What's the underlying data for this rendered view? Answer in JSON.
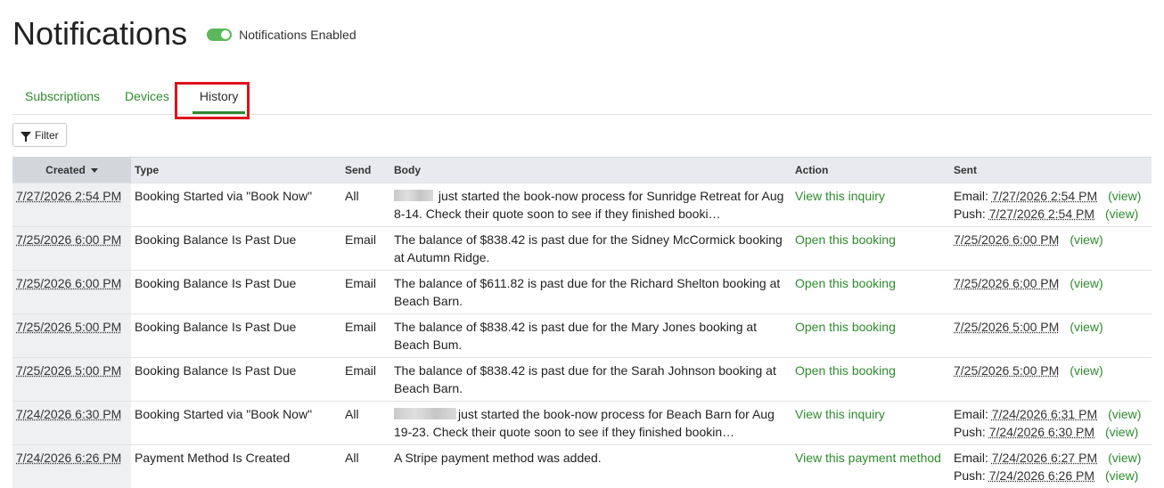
{
  "header": {
    "title": "Notifications",
    "toggle_label": "Notifications Enabled"
  },
  "tabs": [
    {
      "label": "Subscriptions"
    },
    {
      "label": "Devices"
    },
    {
      "label": "History"
    }
  ],
  "filter": {
    "label": "Filter"
  },
  "table": {
    "columns": [
      "Created",
      "Type",
      "Send",
      "Body",
      "Action",
      "Sent"
    ],
    "rows": [
      {
        "created": "7/27/2026 2:54 PM",
        "type": "Booking Started via \"Book Now\"",
        "send": "All",
        "body": " just started the book-now process for Sunridge Retreat for Aug 8-14. Check their quote soon to see if they finished booki…",
        "action": "View this inquiry",
        "sent": [
          {
            "label": "Email:",
            "time": "7/27/2026 2:54 PM",
            "view": "(view)"
          },
          {
            "label": "Push:",
            "time": "7/27/2026 2:54 PM",
            "view": "(view)"
          }
        ]
      },
      {
        "created": "7/25/2026 6:00 PM",
        "type": "Booking Balance Is Past Due",
        "send": "Email",
        "body": "The balance of $838.42 is past due for the Sidney McCormick booking at Autumn Ridge.",
        "action": "Open this booking",
        "sent": [
          {
            "label": "",
            "time": "7/25/2026 6:00 PM",
            "view": "(view)"
          }
        ]
      },
      {
        "created": "7/25/2026 6:00 PM",
        "type": "Booking Balance Is Past Due",
        "send": "Email",
        "body": "The balance of $611.82 is past due for the Richard Shelton booking at Beach Barn.",
        "action": "Open this booking",
        "sent": [
          {
            "label": "",
            "time": "7/25/2026 6:00 PM",
            "view": "(view)"
          }
        ]
      },
      {
        "created": "7/25/2026 5:00 PM",
        "type": "Booking Balance Is Past Due",
        "send": "Email",
        "body": "The balance of $838.42 is past due for the Mary Jones booking at Beach Bum.",
        "action": "Open this booking",
        "sent": [
          {
            "label": "",
            "time": "7/25/2026 5:00 PM",
            "view": "(view)"
          }
        ]
      },
      {
        "created": "7/25/2026 5:00 PM",
        "type": "Booking Balance Is Past Due",
        "send": "Email",
        "body": "The balance of $838.42 is past due for the Sarah Johnson booking at Beach Barn.",
        "action": "Open this booking",
        "sent": [
          {
            "label": "",
            "time": "7/25/2026 5:00 PM",
            "view": "(view)"
          }
        ]
      },
      {
        "created": "7/24/2026 6:30 PM",
        "type": "Booking Started via \"Book Now\"",
        "send": "All",
        "body": "just started the book-now process for Beach Barn for Aug 19-23. Check their quote soon to see if they finished bookin…",
        "action": "View this inquiry",
        "sent": [
          {
            "label": "Email:",
            "time": "7/24/2026 6:31 PM",
            "view": "(view)"
          },
          {
            "label": "Push:",
            "time": "7/24/2026 6:30 PM",
            "view": "(view)"
          }
        ]
      },
      {
        "created": "7/24/2026 6:26 PM",
        "type": "Payment Method Is Created",
        "send": "All",
        "body": "A Stripe payment method was added.",
        "action": "View this payment method",
        "sent": [
          {
            "label": "Email:",
            "time": "7/24/2026 6:27 PM",
            "view": "(view)"
          },
          {
            "label": "Push:",
            "time": "7/24/2026 6:26 PM",
            "view": "(view)"
          }
        ]
      }
    ]
  },
  "colors": {
    "accent": "#2e8b2e",
    "highlight": "#e0121b",
    "toggle_on": "#5cb85c"
  }
}
